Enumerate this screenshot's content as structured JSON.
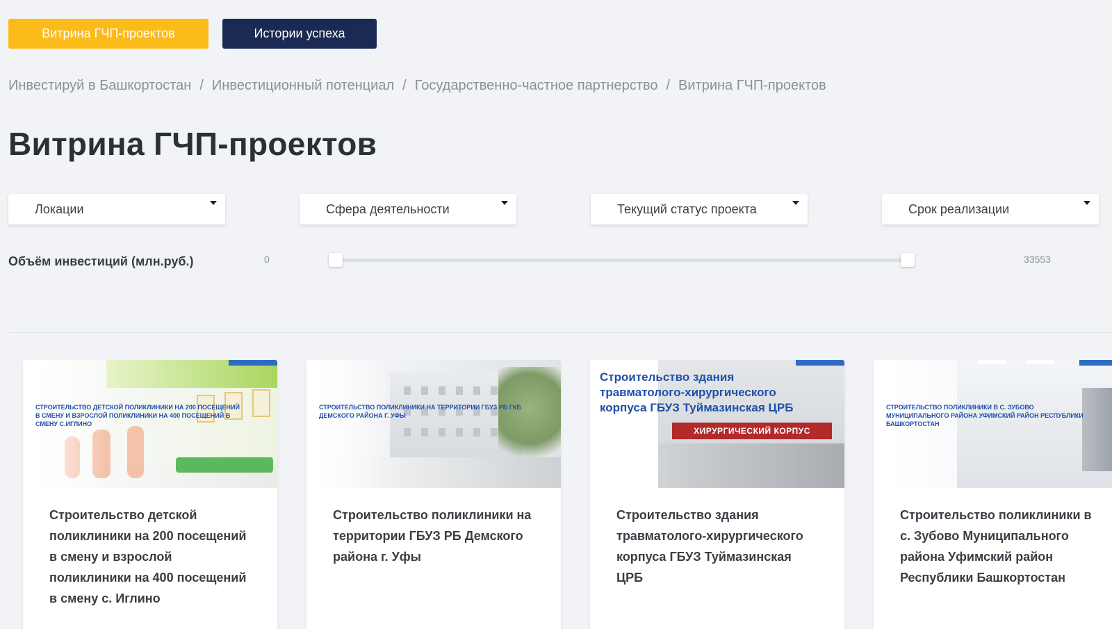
{
  "tabs": {
    "showcase": "Витрина ГЧП-проектов",
    "success_stories": "Истории успеха"
  },
  "breadcrumb": [
    "Инвестируй в Башкортостан",
    "Инвестиционный потенциал",
    "Государственно-частное партнерство",
    "Витрина ГЧП-проектов"
  ],
  "breadcrumb_separator": "/",
  "page_title": "Витрина ГЧП-проектов",
  "filters": {
    "location": "Локации",
    "sphere": "Сфера деятельности",
    "status": "Текущий статус проекта",
    "period": "Срок реализации"
  },
  "investment": {
    "label": "Объём инвестиций (млн.руб.)",
    "min": "0",
    "max": "33553"
  },
  "cards": [
    {
      "image_text": "Строительство детской поликлиники на 200 посещений в смену и взрослой поликлиники на 400 посещений в смену с.Иглино",
      "title": "Строительство детской поликлиники на 200 посещений в смену и взрослой поликлиники на 400 посещений в смену с. Иглино"
    },
    {
      "image_text": "Строительство поликлиники на территории ГБУЗ РБ ГКБ Демского района г. Уфы",
      "title": "Строительство поликлиники на территории ГБУЗ РБ Демского района г. Уфы"
    },
    {
      "image_text": "Строительство здания травматолого-хирургического корпуса ГБУЗ Туймазинская ЦРБ",
      "image_sign": "ХИРУРГИЧЕСКИЙ КОРПУС",
      "title": "Строительство здания травматолого-хирургического корпуса ГБУЗ Туймазинская ЦРБ"
    },
    {
      "image_text": "Строительство поликлиники в с. Зубово Муниципального района Уфимский район Республики Башкортостан",
      "title": "Строительство поликлиники в с. Зубово Муниципального района Уфимский район Республики Башкортостан"
    }
  ],
  "colors": {
    "accent": "#fbbb1b",
    "navy": "#1a2a52",
    "background": "#f1f3f6",
    "image_text_blue": "#1f4fa8"
  }
}
